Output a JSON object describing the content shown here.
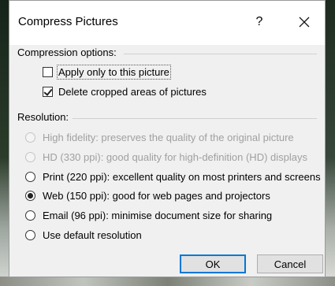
{
  "dialog": {
    "title": "Compress Pictures",
    "help_label": "?",
    "close_label": "✕"
  },
  "compression": {
    "heading": "Compression options:",
    "options": [
      {
        "label": "Apply only to this picture",
        "checked": false
      },
      {
        "label": "Delete cropped areas of pictures",
        "checked": true
      }
    ]
  },
  "resolution": {
    "heading": "Resolution:",
    "options": [
      {
        "label": "High fidelity: preserves the quality of the original picture",
        "enabled": false,
        "selected": false
      },
      {
        "label": "HD (330 ppi): good quality for high-definition (HD) displays",
        "enabled": false,
        "selected": false
      },
      {
        "label": "Print (220 ppi): excellent quality on most printers and screens",
        "enabled": true,
        "selected": false
      },
      {
        "label": "Web (150 ppi): good for web pages and projectors",
        "enabled": true,
        "selected": true
      },
      {
        "label": "Email (96 ppi): minimise document size for sharing",
        "enabled": true,
        "selected": false
      },
      {
        "label": "Use default resolution",
        "enabled": true,
        "selected": false
      }
    ]
  },
  "buttons": {
    "ok": "OK",
    "cancel": "Cancel"
  }
}
